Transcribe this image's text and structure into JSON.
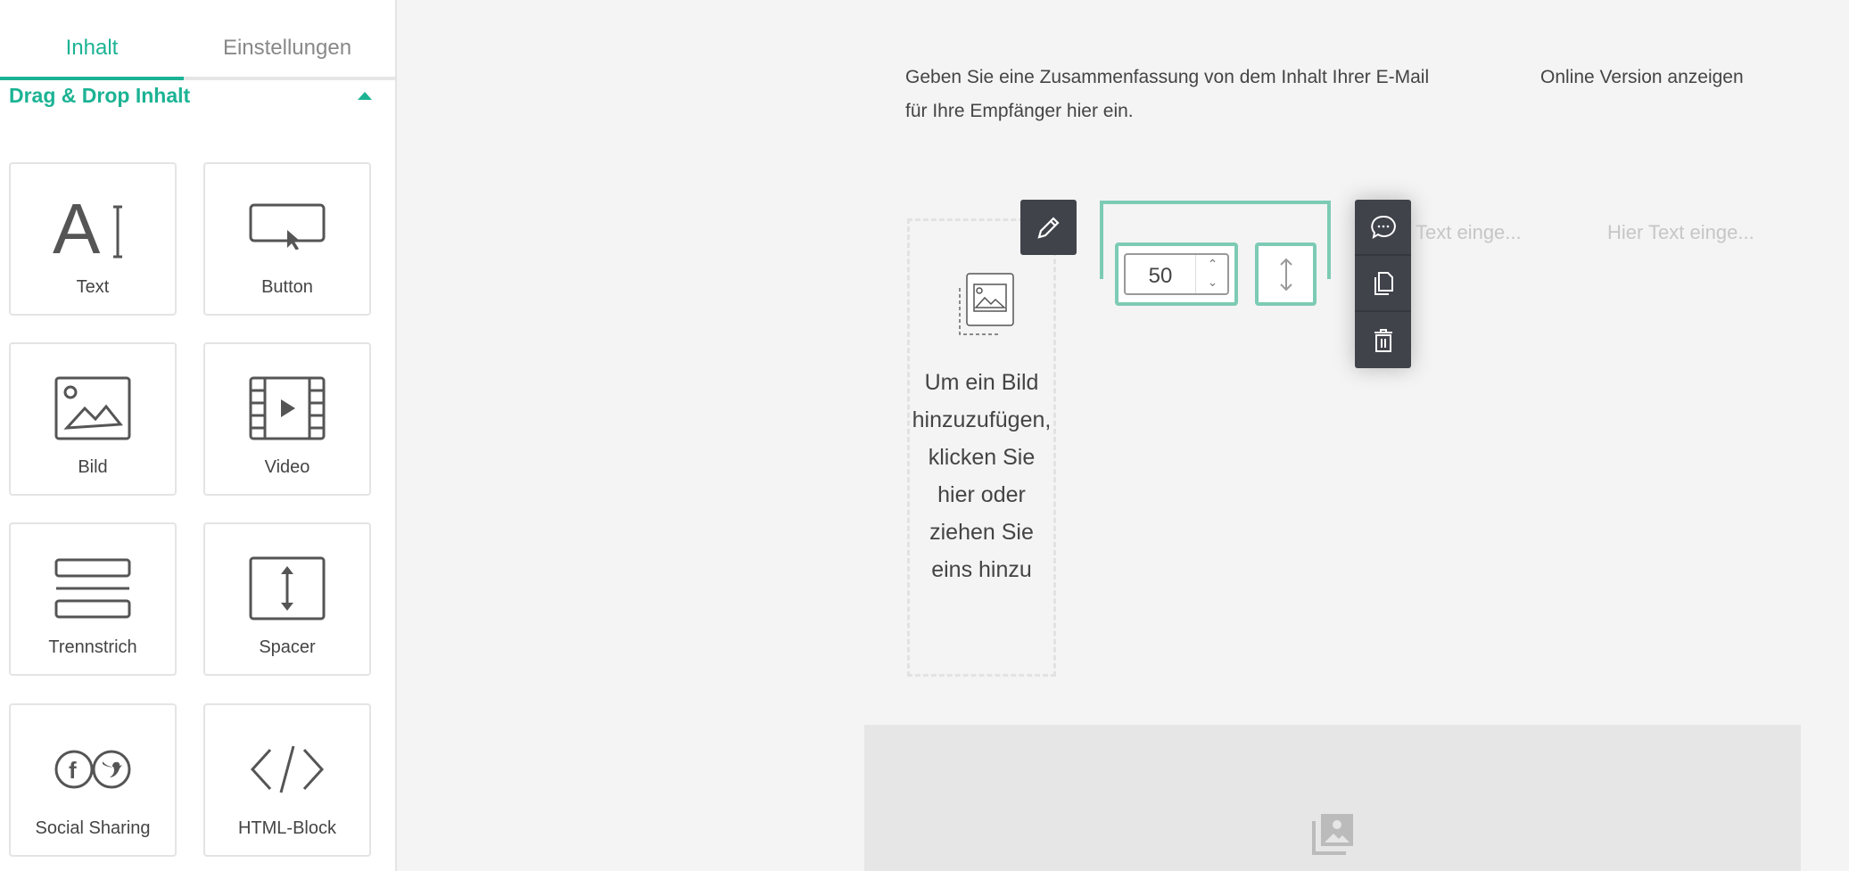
{
  "sidebar": {
    "tabs": [
      {
        "label": "Inhalt",
        "active": true
      },
      {
        "label": "Einstellungen",
        "active": false
      }
    ],
    "section_title": "Drag & Drop Inhalt",
    "tiles": [
      {
        "label": "Text",
        "icon": "text-icon"
      },
      {
        "label": "Button",
        "icon": "button-icon"
      },
      {
        "label": "Bild",
        "icon": "image-icon"
      },
      {
        "label": "Video",
        "icon": "video-icon"
      },
      {
        "label": "Trennstrich",
        "icon": "divider-icon"
      },
      {
        "label": "Spacer",
        "icon": "spacer-icon"
      },
      {
        "label": "Social Sharing",
        "icon": "social-icon"
      },
      {
        "label": "HTML-Block",
        "icon": "code-icon"
      }
    ]
  },
  "canvas": {
    "summary_line1": "Geben Sie eine Zusammenfassung von dem Inhalt Ihrer E-Mail",
    "summary_line2": "für Ihre Empfänger hier ein.",
    "online_version": "Online Version anzeigen",
    "image_placeholder": "Um ein Bild hinzuzufügen, klicken Sie hier oder ziehen Sie eins hinzu",
    "spacer_height": "50",
    "text_placeholder_1": "Text einge...",
    "text_placeholder_2": "Hier Text einge..."
  },
  "colors": {
    "accent": "#1bb394",
    "selection": "#7dcbb4",
    "toolbar": "#41434b"
  }
}
